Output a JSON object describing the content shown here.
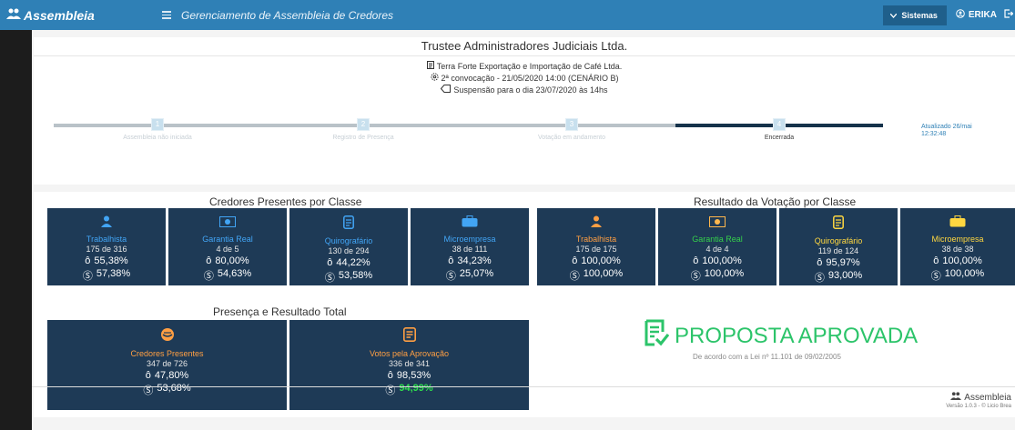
{
  "topbar": {
    "brand": "Assembleia",
    "title": "Gerenciamento de Assembleia de Credores",
    "systems_label": "Sistemas",
    "user": "ERIKA"
  },
  "header": {
    "trustee": "Trustee Administradores Judiciais Ltda.",
    "company": "Terra Forte Exportação e Importação de Café Ltda.",
    "convocation": "2ª convocação - 21/05/2020 14:00 (CENÁRIO B)",
    "suspension": "Suspensão para o dia 23/07/2020 às 14hs"
  },
  "progress": {
    "steps": [
      {
        "label": "Assembleia não iniciada",
        "num": "1"
      },
      {
        "label": "Registro de Presença",
        "num": "2"
      },
      {
        "label": "Votação em andamento",
        "num": "3"
      },
      {
        "label": "Encerrada",
        "num": "4"
      }
    ],
    "updated_line1": "Atualizado 26/mai",
    "updated_line2": "12:32:48"
  },
  "present": {
    "title": "Credores Presentes por Classe",
    "tiles": [
      {
        "name": "Trabalhista",
        "count": "175 de 316",
        "pct1": "55,38%",
        "pct2": "57,38%",
        "icon": "person-icon"
      },
      {
        "name": "Garantia Real",
        "count": "4 de 5",
        "pct1": "80,00%",
        "pct2": "54,63%",
        "icon": "money-icon"
      },
      {
        "name": "Quirografário",
        "count": "130 de 294",
        "pct1": "44,22%",
        "pct2": "53,58%",
        "icon": "document-icon"
      },
      {
        "name": "Microempresa",
        "count": "38 de 111",
        "pct1": "34,23%",
        "pct2": "25,07%",
        "icon": "briefcase-icon"
      }
    ]
  },
  "result": {
    "title": "Resultado da Votação por Classe",
    "tiles": [
      {
        "name": "Trabalhista",
        "count": "175 de 175",
        "pct1": "100,00%",
        "pct2": "100,00%",
        "icon": "person-icon"
      },
      {
        "name": "Garantia Real",
        "count": "4 de 4",
        "pct1": "100,00%",
        "pct2": "100,00%",
        "icon": "money-icon"
      },
      {
        "name": "Quirografário",
        "count": "119 de 124",
        "pct1": "95,97%",
        "pct2": "93,00%",
        "icon": "document-icon"
      },
      {
        "name": "Microempresa",
        "count": "38 de 38",
        "pct1": "100,00%",
        "pct2": "100,00%",
        "icon": "briefcase-icon"
      }
    ]
  },
  "total": {
    "title": "Presença e Resultado Total",
    "present": {
      "name": "Credores Presentes",
      "count": "347 de 726",
      "pct1": "47,80%",
      "pct2": "53,68%"
    },
    "votes": {
      "name": "Votos pela Aprovação",
      "count": "336 de 341",
      "pct1": "98,53%",
      "pct2": "94,99%"
    }
  },
  "approval": {
    "text": "PROPOSTA APROVADA",
    "law": "De acordo com a Lei nº 11.101 de 09/02/2005"
  },
  "footer": {
    "brand": "Assembleia",
    "version": "Versão 1.0.3 - © Licio Brea"
  },
  "colors": {
    "topbar": "#2f80b6",
    "tile_bg": "#1e3a56",
    "approved": "#2cc46a",
    "orange": "#ff9f43",
    "blue": "#42a5f5",
    "green": "#35d04b",
    "yellow": "#ffd740"
  }
}
